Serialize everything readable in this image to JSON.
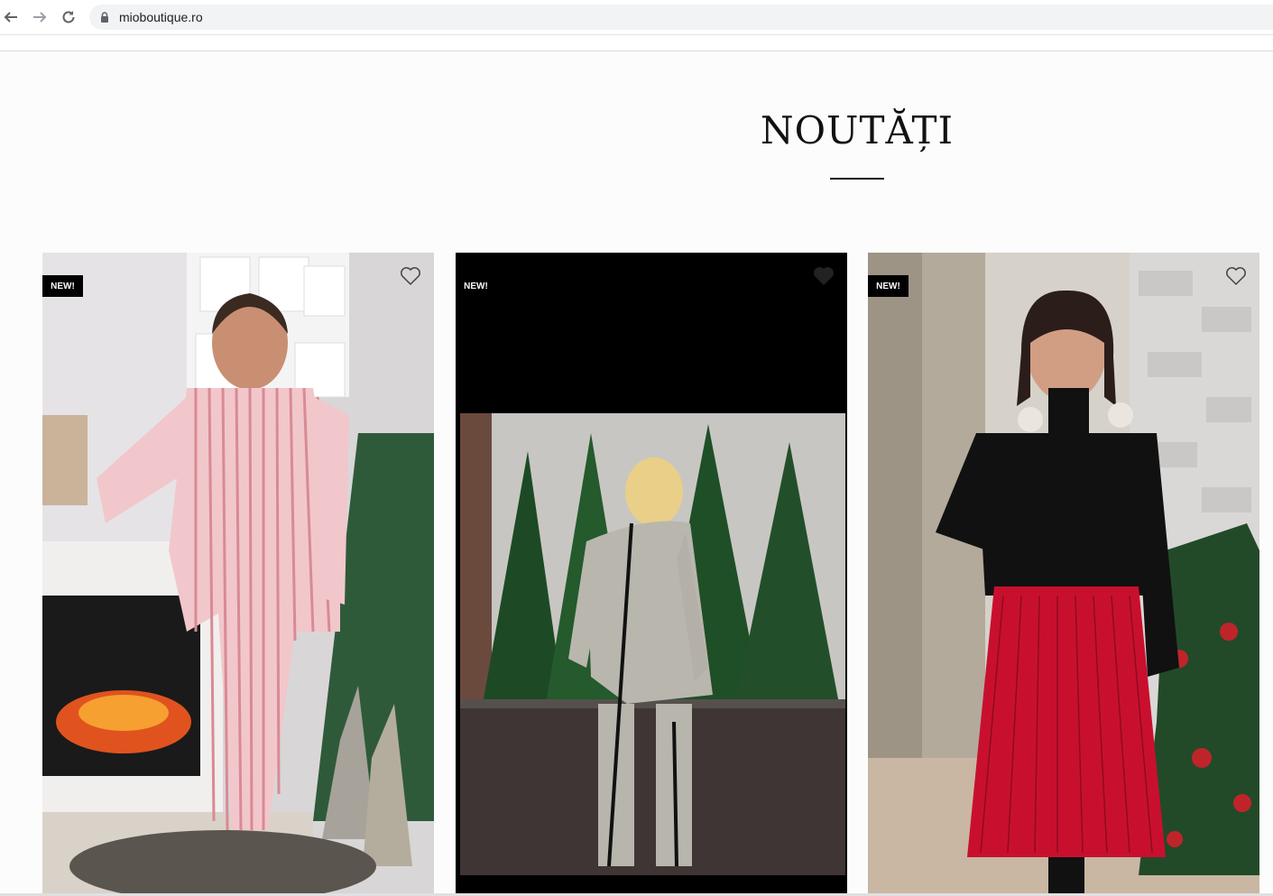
{
  "browser": {
    "url": "mioboutique.ro"
  },
  "section": {
    "title": "NOUTĂȚI"
  },
  "products": [
    {
      "badge": "NEW!",
      "description": "Woman in pink striped satin pajamas next to fireplace and Christmas tree"
    },
    {
      "badge": "NEW!",
      "description": "Woman in grey hooded tracksuit with black stripe in front of evergreen trees"
    },
    {
      "badge": "NEW!",
      "description": "Woman in black sweater with pearl shoulders and red pleated skirt next to Christmas tree"
    }
  ],
  "colors": {
    "badge_bg": "#000000",
    "badge_text": "#ffffff",
    "title": "#111111",
    "page_bg": "#fcfcfc"
  },
  "icons": {
    "back": "arrow-left-icon",
    "forward": "arrow-right-icon",
    "reload": "reload-icon",
    "lock": "lock-icon",
    "wishlist": "heart-icon"
  }
}
